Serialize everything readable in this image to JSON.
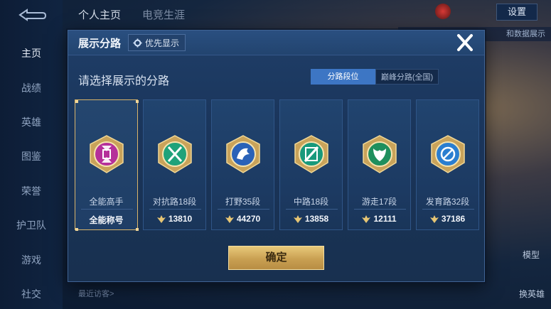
{
  "nav": {
    "items": [
      {
        "label": "主页",
        "active": true
      },
      {
        "label": "战绩",
        "active": false
      },
      {
        "label": "英雄",
        "active": false
      },
      {
        "label": "图鉴",
        "active": false
      },
      {
        "label": "荣誉",
        "active": false
      },
      {
        "label": "护卫队",
        "active": false
      },
      {
        "label": "游戏",
        "active": false
      },
      {
        "label": "社交",
        "active": false
      }
    ]
  },
  "top_tabs": [
    "个人主页",
    "电竞生涯"
  ],
  "settings_label": "设置",
  "right_strip_text": "和数据展示",
  "side_labels": {
    "model": "模型",
    "switch_hero": "换英雄"
  },
  "visitors_label": "最近访客>",
  "modal": {
    "title": "展示分路",
    "priority_label": "优先显示",
    "subtitle": "请选择展示的分路",
    "segments": [
      {
        "label": "分路段位",
        "active": true
      },
      {
        "label": "巅峰分路(全国)",
        "active": false
      }
    ],
    "cards": [
      {
        "name": "全能高手",
        "score": "全能称号",
        "icon": "all-round-emblem-icon",
        "color": "#b5309a",
        "selected": true,
        "show_power": false
      },
      {
        "name": "对抗路18段",
        "score": "13810",
        "icon": "clash-lane-emblem-icon",
        "color": "#1fa27a",
        "selected": false,
        "show_power": true
      },
      {
        "name": "打野35段",
        "score": "44270",
        "icon": "jungle-emblem-icon",
        "color": "#2a62b8",
        "selected": false,
        "show_power": true
      },
      {
        "name": "中路18段",
        "score": "13858",
        "icon": "mid-lane-emblem-icon",
        "color": "#17997b",
        "selected": false,
        "show_power": true
      },
      {
        "name": "游走17段",
        "score": "12111",
        "icon": "roam-emblem-icon",
        "color": "#1f8f5d",
        "selected": false,
        "show_power": true
      },
      {
        "name": "发育路32段",
        "score": "37186",
        "icon": "farm-lane-emblem-icon",
        "color": "#2a7ed0",
        "selected": false,
        "show_power": true
      }
    ],
    "confirm_label": "确定"
  }
}
